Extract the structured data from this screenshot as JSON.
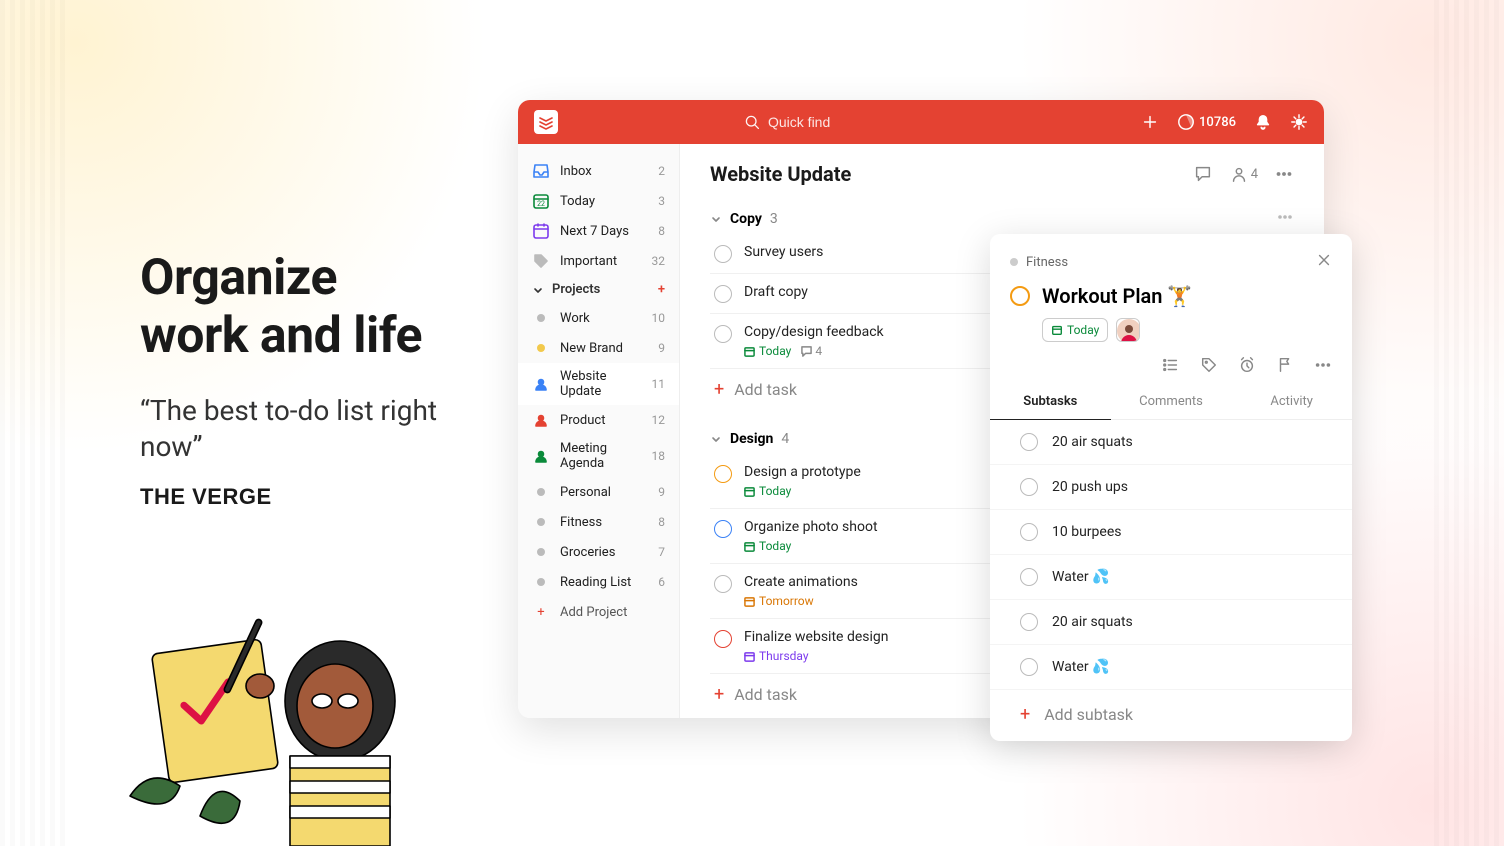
{
  "hero": {
    "title_l1": "Organize",
    "title_l2": "work and life",
    "quote": "“The best to-do list right now”",
    "source": "THE VERGE"
  },
  "topbar": {
    "search_placeholder": "Quick find",
    "karma": "10786"
  },
  "sidebar": {
    "nav": [
      {
        "key": "inbox",
        "label": "Inbox",
        "count": "2",
        "icon": "inbox",
        "color": "#3b82f6"
      },
      {
        "key": "today",
        "label": "Today",
        "count": "3",
        "icon": "today",
        "color": "#0a8a3a"
      },
      {
        "key": "next7",
        "label": "Next 7 Days",
        "count": "8",
        "icon": "calendar",
        "color": "#7c3aed"
      },
      {
        "key": "important",
        "label": "Important",
        "count": "32",
        "icon": "tag",
        "color": "#bbb"
      }
    ],
    "projects_header": "Projects",
    "projects": [
      {
        "label": "Work",
        "count": "10",
        "dot": "#bbb"
      },
      {
        "label": "New Brand",
        "count": "9",
        "dot": "#f2c94c"
      },
      {
        "label": "Website Update",
        "count": "11",
        "dot": "#3b82f6",
        "selected": true,
        "person": true
      },
      {
        "label": "Product",
        "count": "12",
        "dot": "#e44232",
        "person": true
      },
      {
        "label": "Meeting Agenda",
        "count": "18",
        "dot": "#0a8a3a",
        "person": true
      },
      {
        "label": "Personal",
        "count": "9",
        "dot": "#bbb"
      },
      {
        "label": "Fitness",
        "count": "8",
        "dot": "#bbb"
      },
      {
        "label": "Groceries",
        "count": "7",
        "dot": "#bbb"
      },
      {
        "label": "Reading List",
        "count": "6",
        "dot": "#bbb"
      }
    ],
    "add_project": "Add Project"
  },
  "main": {
    "title": "Website Update",
    "share_count": "4",
    "sections": [
      {
        "name": "Copy",
        "count": "3",
        "tasks": [
          {
            "title": "Survey users",
            "circle": "",
            "meta": []
          },
          {
            "title": "Draft copy",
            "circle": "",
            "meta": []
          },
          {
            "title": "Copy/design feedback",
            "circle": "",
            "meta": [
              {
                "type": "date",
                "text": "Today",
                "cls": "green"
              },
              {
                "type": "cmt",
                "text": "4"
              }
            ]
          }
        ]
      },
      {
        "name": "Design",
        "count": "4",
        "tasks": [
          {
            "title": "Design a prototype",
            "circle": "orange",
            "meta": [
              {
                "type": "date",
                "text": "Today",
                "cls": "green"
              }
            ]
          },
          {
            "title": "Organize photo shoot",
            "circle": "blue",
            "meta": [
              {
                "type": "date",
                "text": "Today",
                "cls": "green"
              }
            ]
          },
          {
            "title": "Create animations",
            "circle": "",
            "meta": [
              {
                "type": "date",
                "text": "Tomorrow",
                "cls": "orange"
              }
            ]
          },
          {
            "title": "Finalize website design",
            "circle": "red",
            "meta": [
              {
                "type": "date",
                "text": "Thursday",
                "cls": "purple"
              }
            ]
          }
        ]
      }
    ],
    "add_task": "Add task"
  },
  "card": {
    "project": "Fitness",
    "title": "Workout Plan 🏋️",
    "today": "Today",
    "tabs": [
      "Subtasks",
      "Comments",
      "Activity"
    ],
    "active_tab": 0,
    "subtasks": [
      "20 air squats",
      "20 push ups",
      "10 burpees",
      "Water 💦",
      "20 air squats",
      "Water 💦"
    ],
    "add_subtask": "Add subtask"
  }
}
